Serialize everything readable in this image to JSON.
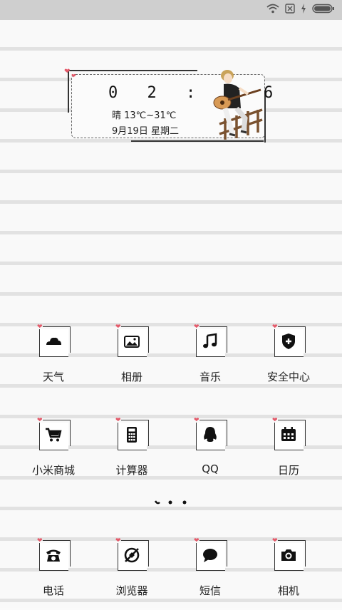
{
  "status_bar": {
    "icons": [
      "wifi-icon",
      "sim-x-icon",
      "charging-icon",
      "battery-icon"
    ]
  },
  "widget": {
    "time": "0 2 : 3 6",
    "weather": "晴 13℃~31℃",
    "date": "9月19日 星期二"
  },
  "apps_row1": [
    {
      "label": "天气",
      "icon": "cloud-icon"
    },
    {
      "label": "相册",
      "icon": "image-icon"
    },
    {
      "label": "音乐",
      "icon": "music-note-icon"
    },
    {
      "label": "安全中心",
      "icon": "shield-plus-icon"
    }
  ],
  "apps_row2": [
    {
      "label": "小米商城",
      "icon": "cart-icon"
    },
    {
      "label": "计算器",
      "icon": "calculator-icon"
    },
    {
      "label": "QQ",
      "icon": "penguin-icon"
    },
    {
      "label": "日历",
      "icon": "calendar-icon"
    }
  ],
  "dock": [
    {
      "label": "电话",
      "icon": "phone-icon"
    },
    {
      "label": "浏览器",
      "icon": "browser-icon"
    },
    {
      "label": "短信",
      "icon": "message-icon"
    },
    {
      "label": "相机",
      "icon": "camera-icon"
    }
  ],
  "page_indicator": {
    "count": 3,
    "active": 0
  },
  "colors": {
    "accent_heart": "#e45a6a",
    "statusbar": "#cfcfcf",
    "line": "#e2e2e2"
  }
}
